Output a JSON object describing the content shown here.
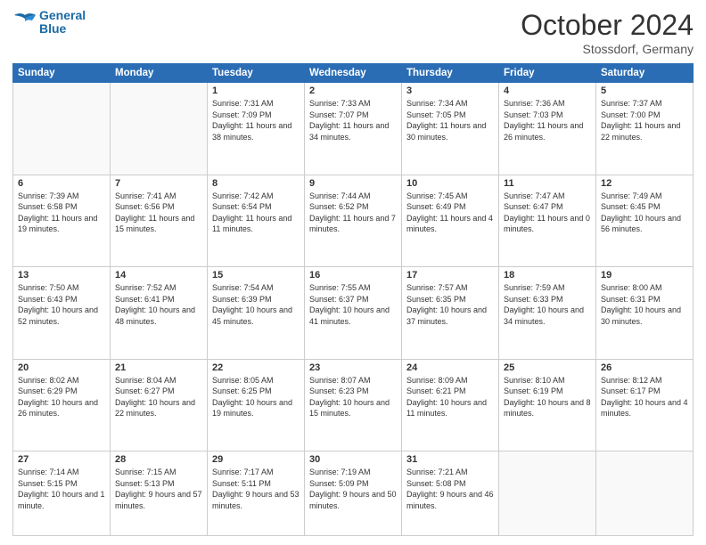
{
  "header": {
    "logo_line1": "General",
    "logo_line2": "Blue",
    "month": "October 2024",
    "location": "Stossdorf, Germany"
  },
  "weekdays": [
    "Sunday",
    "Monday",
    "Tuesday",
    "Wednesday",
    "Thursday",
    "Friday",
    "Saturday"
  ],
  "weeks": [
    [
      {
        "day": null,
        "info": null
      },
      {
        "day": null,
        "info": null
      },
      {
        "day": "1",
        "info": "Sunrise: 7:31 AM\nSunset: 7:09 PM\nDaylight: 11 hours and 38 minutes."
      },
      {
        "day": "2",
        "info": "Sunrise: 7:33 AM\nSunset: 7:07 PM\nDaylight: 11 hours and 34 minutes."
      },
      {
        "day": "3",
        "info": "Sunrise: 7:34 AM\nSunset: 7:05 PM\nDaylight: 11 hours and 30 minutes."
      },
      {
        "day": "4",
        "info": "Sunrise: 7:36 AM\nSunset: 7:03 PM\nDaylight: 11 hours and 26 minutes."
      },
      {
        "day": "5",
        "info": "Sunrise: 7:37 AM\nSunset: 7:00 PM\nDaylight: 11 hours and 22 minutes."
      }
    ],
    [
      {
        "day": "6",
        "info": "Sunrise: 7:39 AM\nSunset: 6:58 PM\nDaylight: 11 hours and 19 minutes."
      },
      {
        "day": "7",
        "info": "Sunrise: 7:41 AM\nSunset: 6:56 PM\nDaylight: 11 hours and 15 minutes."
      },
      {
        "day": "8",
        "info": "Sunrise: 7:42 AM\nSunset: 6:54 PM\nDaylight: 11 hours and 11 minutes."
      },
      {
        "day": "9",
        "info": "Sunrise: 7:44 AM\nSunset: 6:52 PM\nDaylight: 11 hours and 7 minutes."
      },
      {
        "day": "10",
        "info": "Sunrise: 7:45 AM\nSunset: 6:49 PM\nDaylight: 11 hours and 4 minutes."
      },
      {
        "day": "11",
        "info": "Sunrise: 7:47 AM\nSunset: 6:47 PM\nDaylight: 11 hours and 0 minutes."
      },
      {
        "day": "12",
        "info": "Sunrise: 7:49 AM\nSunset: 6:45 PM\nDaylight: 10 hours and 56 minutes."
      }
    ],
    [
      {
        "day": "13",
        "info": "Sunrise: 7:50 AM\nSunset: 6:43 PM\nDaylight: 10 hours and 52 minutes."
      },
      {
        "day": "14",
        "info": "Sunrise: 7:52 AM\nSunset: 6:41 PM\nDaylight: 10 hours and 48 minutes."
      },
      {
        "day": "15",
        "info": "Sunrise: 7:54 AM\nSunset: 6:39 PM\nDaylight: 10 hours and 45 minutes."
      },
      {
        "day": "16",
        "info": "Sunrise: 7:55 AM\nSunset: 6:37 PM\nDaylight: 10 hours and 41 minutes."
      },
      {
        "day": "17",
        "info": "Sunrise: 7:57 AM\nSunset: 6:35 PM\nDaylight: 10 hours and 37 minutes."
      },
      {
        "day": "18",
        "info": "Sunrise: 7:59 AM\nSunset: 6:33 PM\nDaylight: 10 hours and 34 minutes."
      },
      {
        "day": "19",
        "info": "Sunrise: 8:00 AM\nSunset: 6:31 PM\nDaylight: 10 hours and 30 minutes."
      }
    ],
    [
      {
        "day": "20",
        "info": "Sunrise: 8:02 AM\nSunset: 6:29 PM\nDaylight: 10 hours and 26 minutes."
      },
      {
        "day": "21",
        "info": "Sunrise: 8:04 AM\nSunset: 6:27 PM\nDaylight: 10 hours and 22 minutes."
      },
      {
        "day": "22",
        "info": "Sunrise: 8:05 AM\nSunset: 6:25 PM\nDaylight: 10 hours and 19 minutes."
      },
      {
        "day": "23",
        "info": "Sunrise: 8:07 AM\nSunset: 6:23 PM\nDaylight: 10 hours and 15 minutes."
      },
      {
        "day": "24",
        "info": "Sunrise: 8:09 AM\nSunset: 6:21 PM\nDaylight: 10 hours and 11 minutes."
      },
      {
        "day": "25",
        "info": "Sunrise: 8:10 AM\nSunset: 6:19 PM\nDaylight: 10 hours and 8 minutes."
      },
      {
        "day": "26",
        "info": "Sunrise: 8:12 AM\nSunset: 6:17 PM\nDaylight: 10 hours and 4 minutes."
      }
    ],
    [
      {
        "day": "27",
        "info": "Sunrise: 7:14 AM\nSunset: 5:15 PM\nDaylight: 10 hours and 1 minute."
      },
      {
        "day": "28",
        "info": "Sunrise: 7:15 AM\nSunset: 5:13 PM\nDaylight: 9 hours and 57 minutes."
      },
      {
        "day": "29",
        "info": "Sunrise: 7:17 AM\nSunset: 5:11 PM\nDaylight: 9 hours and 53 minutes."
      },
      {
        "day": "30",
        "info": "Sunrise: 7:19 AM\nSunset: 5:09 PM\nDaylight: 9 hours and 50 minutes."
      },
      {
        "day": "31",
        "info": "Sunrise: 7:21 AM\nSunset: 5:08 PM\nDaylight: 9 hours and 46 minutes."
      },
      {
        "day": null,
        "info": null
      },
      {
        "day": null,
        "info": null
      }
    ]
  ]
}
